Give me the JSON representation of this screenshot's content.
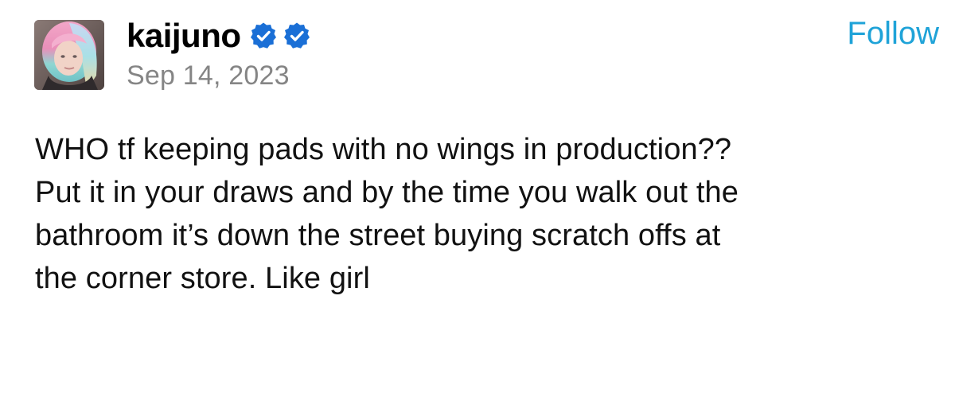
{
  "post": {
    "author": {
      "username": "kaijuno",
      "avatar_icon": "profile-photo"
    },
    "badges": [
      {
        "icon": "verified-check-icon",
        "color": "#1a6fd6"
      },
      {
        "icon": "verified-check-icon",
        "color": "#1a6fd6"
      }
    ],
    "date": "Sep 14, 2023",
    "follow_label": "Follow",
    "accent_color": "#1fa3d8",
    "body_lines": [
      "WHO tf keeping pads with no wings in production??",
      "Put it in your draws and by the time you walk out the",
      "bathroom it’s down the street buying scratch offs at",
      "the corner store. Like girl"
    ]
  }
}
